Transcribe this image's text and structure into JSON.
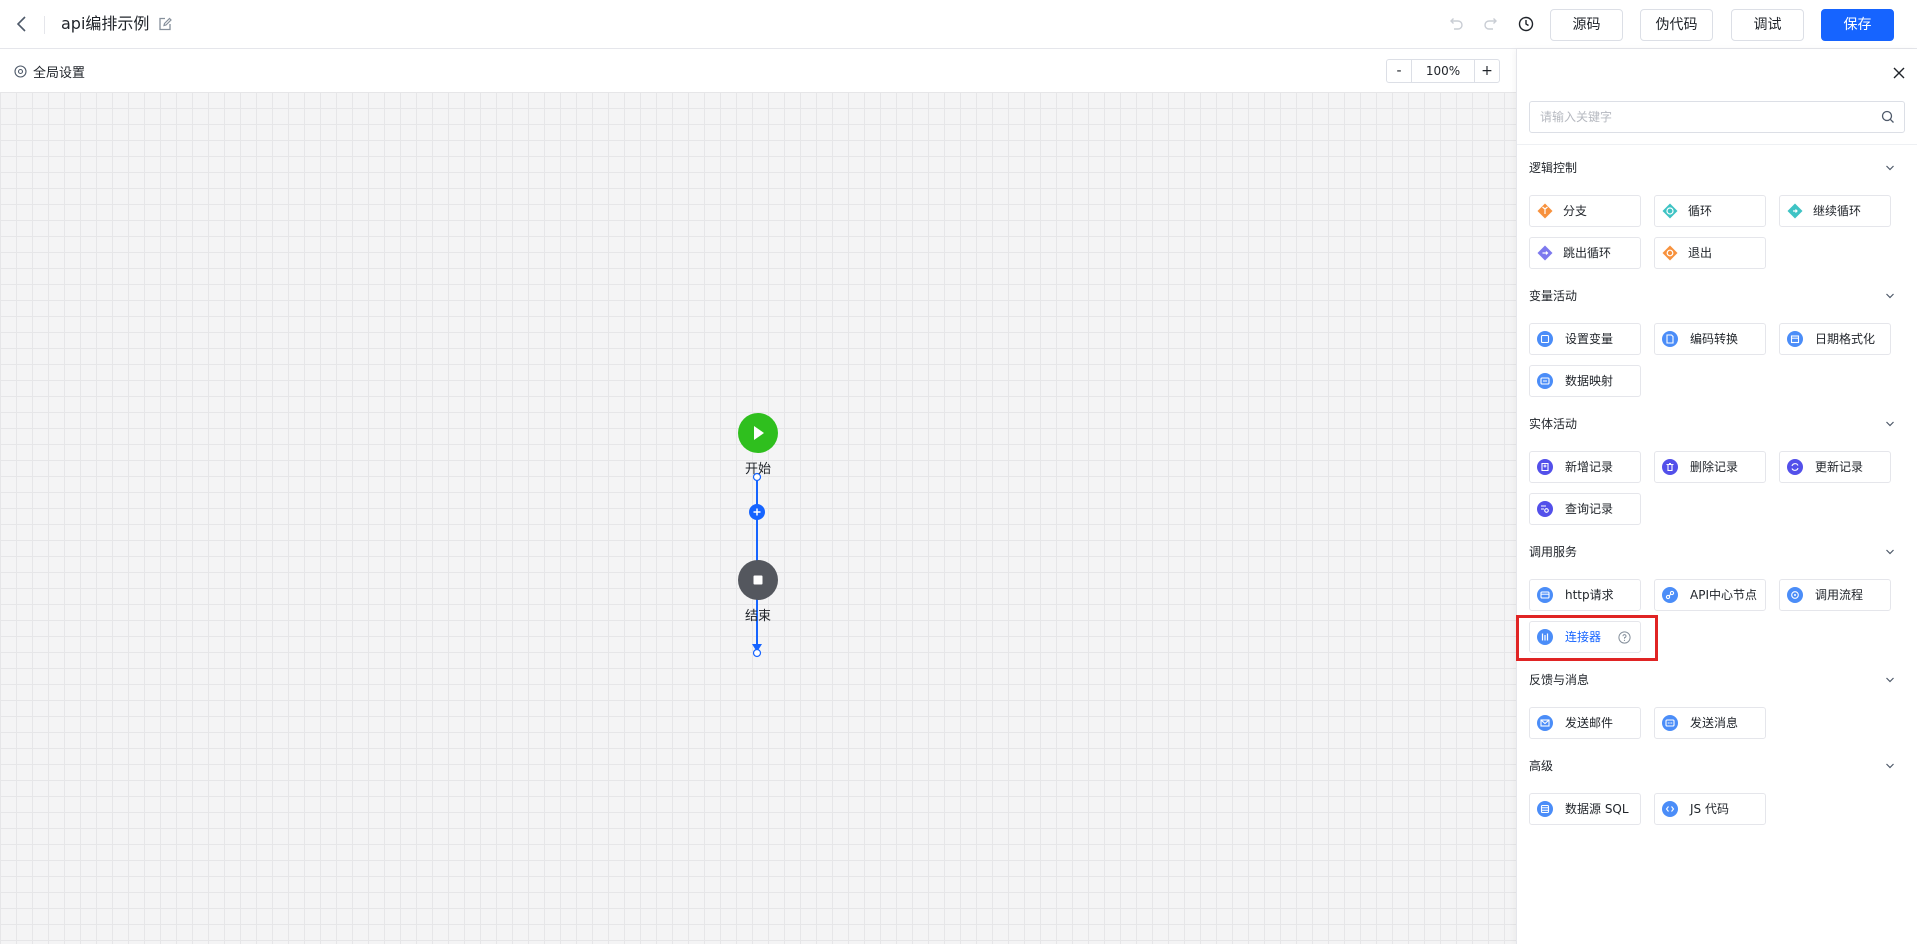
{
  "header": {
    "title": "api编排示例",
    "buttons": {
      "source": "源码",
      "pseudo": "伪代码",
      "debug": "调试",
      "save": "保存"
    }
  },
  "toolbar": {
    "global_settings": "全局设置",
    "zoom_minus": "-",
    "zoom_value": "100%",
    "zoom_plus": "+"
  },
  "flow": {
    "start_label": "开始",
    "end_label": "结束"
  },
  "panel": {
    "search_placeholder": "请输入关键字",
    "sections": [
      {
        "title": "逻辑控制",
        "items": [
          "分支",
          "循环",
          "继续循环",
          "跳出循环",
          "退出"
        ]
      },
      {
        "title": "变量活动",
        "items": [
          "设置变量",
          "编码转换",
          "日期格式化",
          "数据映射"
        ]
      },
      {
        "title": "实体活动",
        "items": [
          "新增记录",
          "删除记录",
          "更新记录",
          "查询记录"
        ]
      },
      {
        "title": "调用服务",
        "items": [
          "http请求",
          "API中心节点",
          "调用流程",
          "连接器"
        ]
      },
      {
        "title": "反馈与消息",
        "items": [
          "发送邮件",
          "发送消息"
        ]
      },
      {
        "title": "高级",
        "items": [
          "数据源 SQL",
          "JS 代码"
        ]
      }
    ]
  },
  "colors": {
    "primary": "#1664ff",
    "start": "#2fbf1e",
    "end": "#54575e",
    "highlight": "#e02424",
    "orange": "#f7913d",
    "teal": "#3ec3c4",
    "purple": "#7d79ee",
    "indigo": "#5350ea",
    "blue": "#4b8df8"
  }
}
